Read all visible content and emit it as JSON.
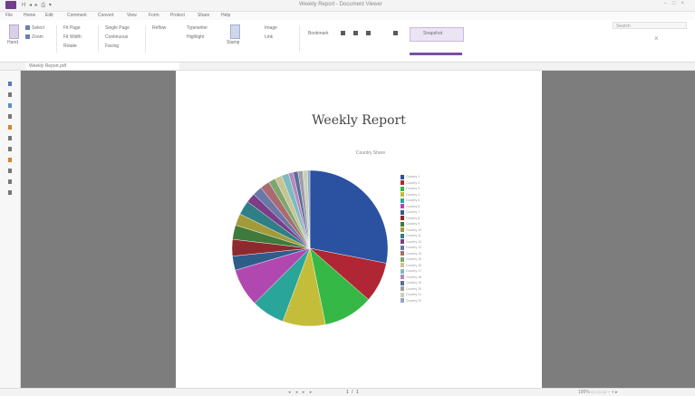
{
  "window": {
    "title": "Weekly Report - Document Viewer",
    "quick_access": "H ◂ ▸ ⎙ ▾"
  },
  "menu": [
    "File",
    "Home",
    "Edit",
    "Comment",
    "Convert",
    "View",
    "Form",
    "Protect",
    "Share",
    "Help"
  ],
  "ribbon": {
    "buttons": [
      "Hand",
      "Select",
      "Zoom",
      "Fit Page",
      "Fit Width",
      "Rotate",
      "Single Page",
      "Continuous",
      "Facing",
      "Reflow",
      "Typewriter",
      "Highlight",
      "Stamp",
      "Image",
      "Link",
      "Bookmark"
    ],
    "active_tool": "Snapshot",
    "search_placeholder": "Search"
  },
  "tab": {
    "name": "Weekly Report.pdf"
  },
  "document": {
    "title": "Weekly Report",
    "subtitle": "Country Share"
  },
  "chart_data": {
    "type": "pie",
    "title": "Weekly Report",
    "subtitle": "Country Share",
    "legend_position": "right",
    "categories": [
      "Country 1",
      "Country 2",
      "Country 3",
      "Country 4",
      "Country 5",
      "Country 6",
      "Country 7",
      "Country 8",
      "Country 9",
      "Country 10",
      "Country 11",
      "Country 12",
      "Country 13",
      "Country 14",
      "Country 15",
      "Country 16",
      "Country 17",
      "Country 18",
      "Country 19",
      "Country 20",
      "Country 21",
      "Country 22"
    ],
    "values": [
      28.5,
      8.5,
      10.5,
      9,
      7,
      8,
      3,
      3.5,
      3,
      2.5,
      3,
      2,
      2,
      2,
      1.5,
      1.5,
      1.5,
      1,
      1,
      1,
      1,
      0.5
    ],
    "colors": [
      "#2a52a0",
      "#b02634",
      "#35b845",
      "#c4bd3a",
      "#2aa59a",
      "#b048b0",
      "#2f5d8a",
      "#8e2a2f",
      "#3f7a3c",
      "#a39a3a",
      "#2e7f86",
      "#7a3e86",
      "#6a78a8",
      "#a96b6f",
      "#7ea66f",
      "#c7c493",
      "#7cbcc0",
      "#b389bf",
      "#5e6d99",
      "#9da0a8",
      "#c9cfb9",
      "#8fa6c7"
    ]
  },
  "status": {
    "page_indicator": "1 / 1",
    "nav": "◂ ◂ ▸ ▸",
    "zoom": "100%  ▭ ▭ ▭ − + ▸"
  }
}
